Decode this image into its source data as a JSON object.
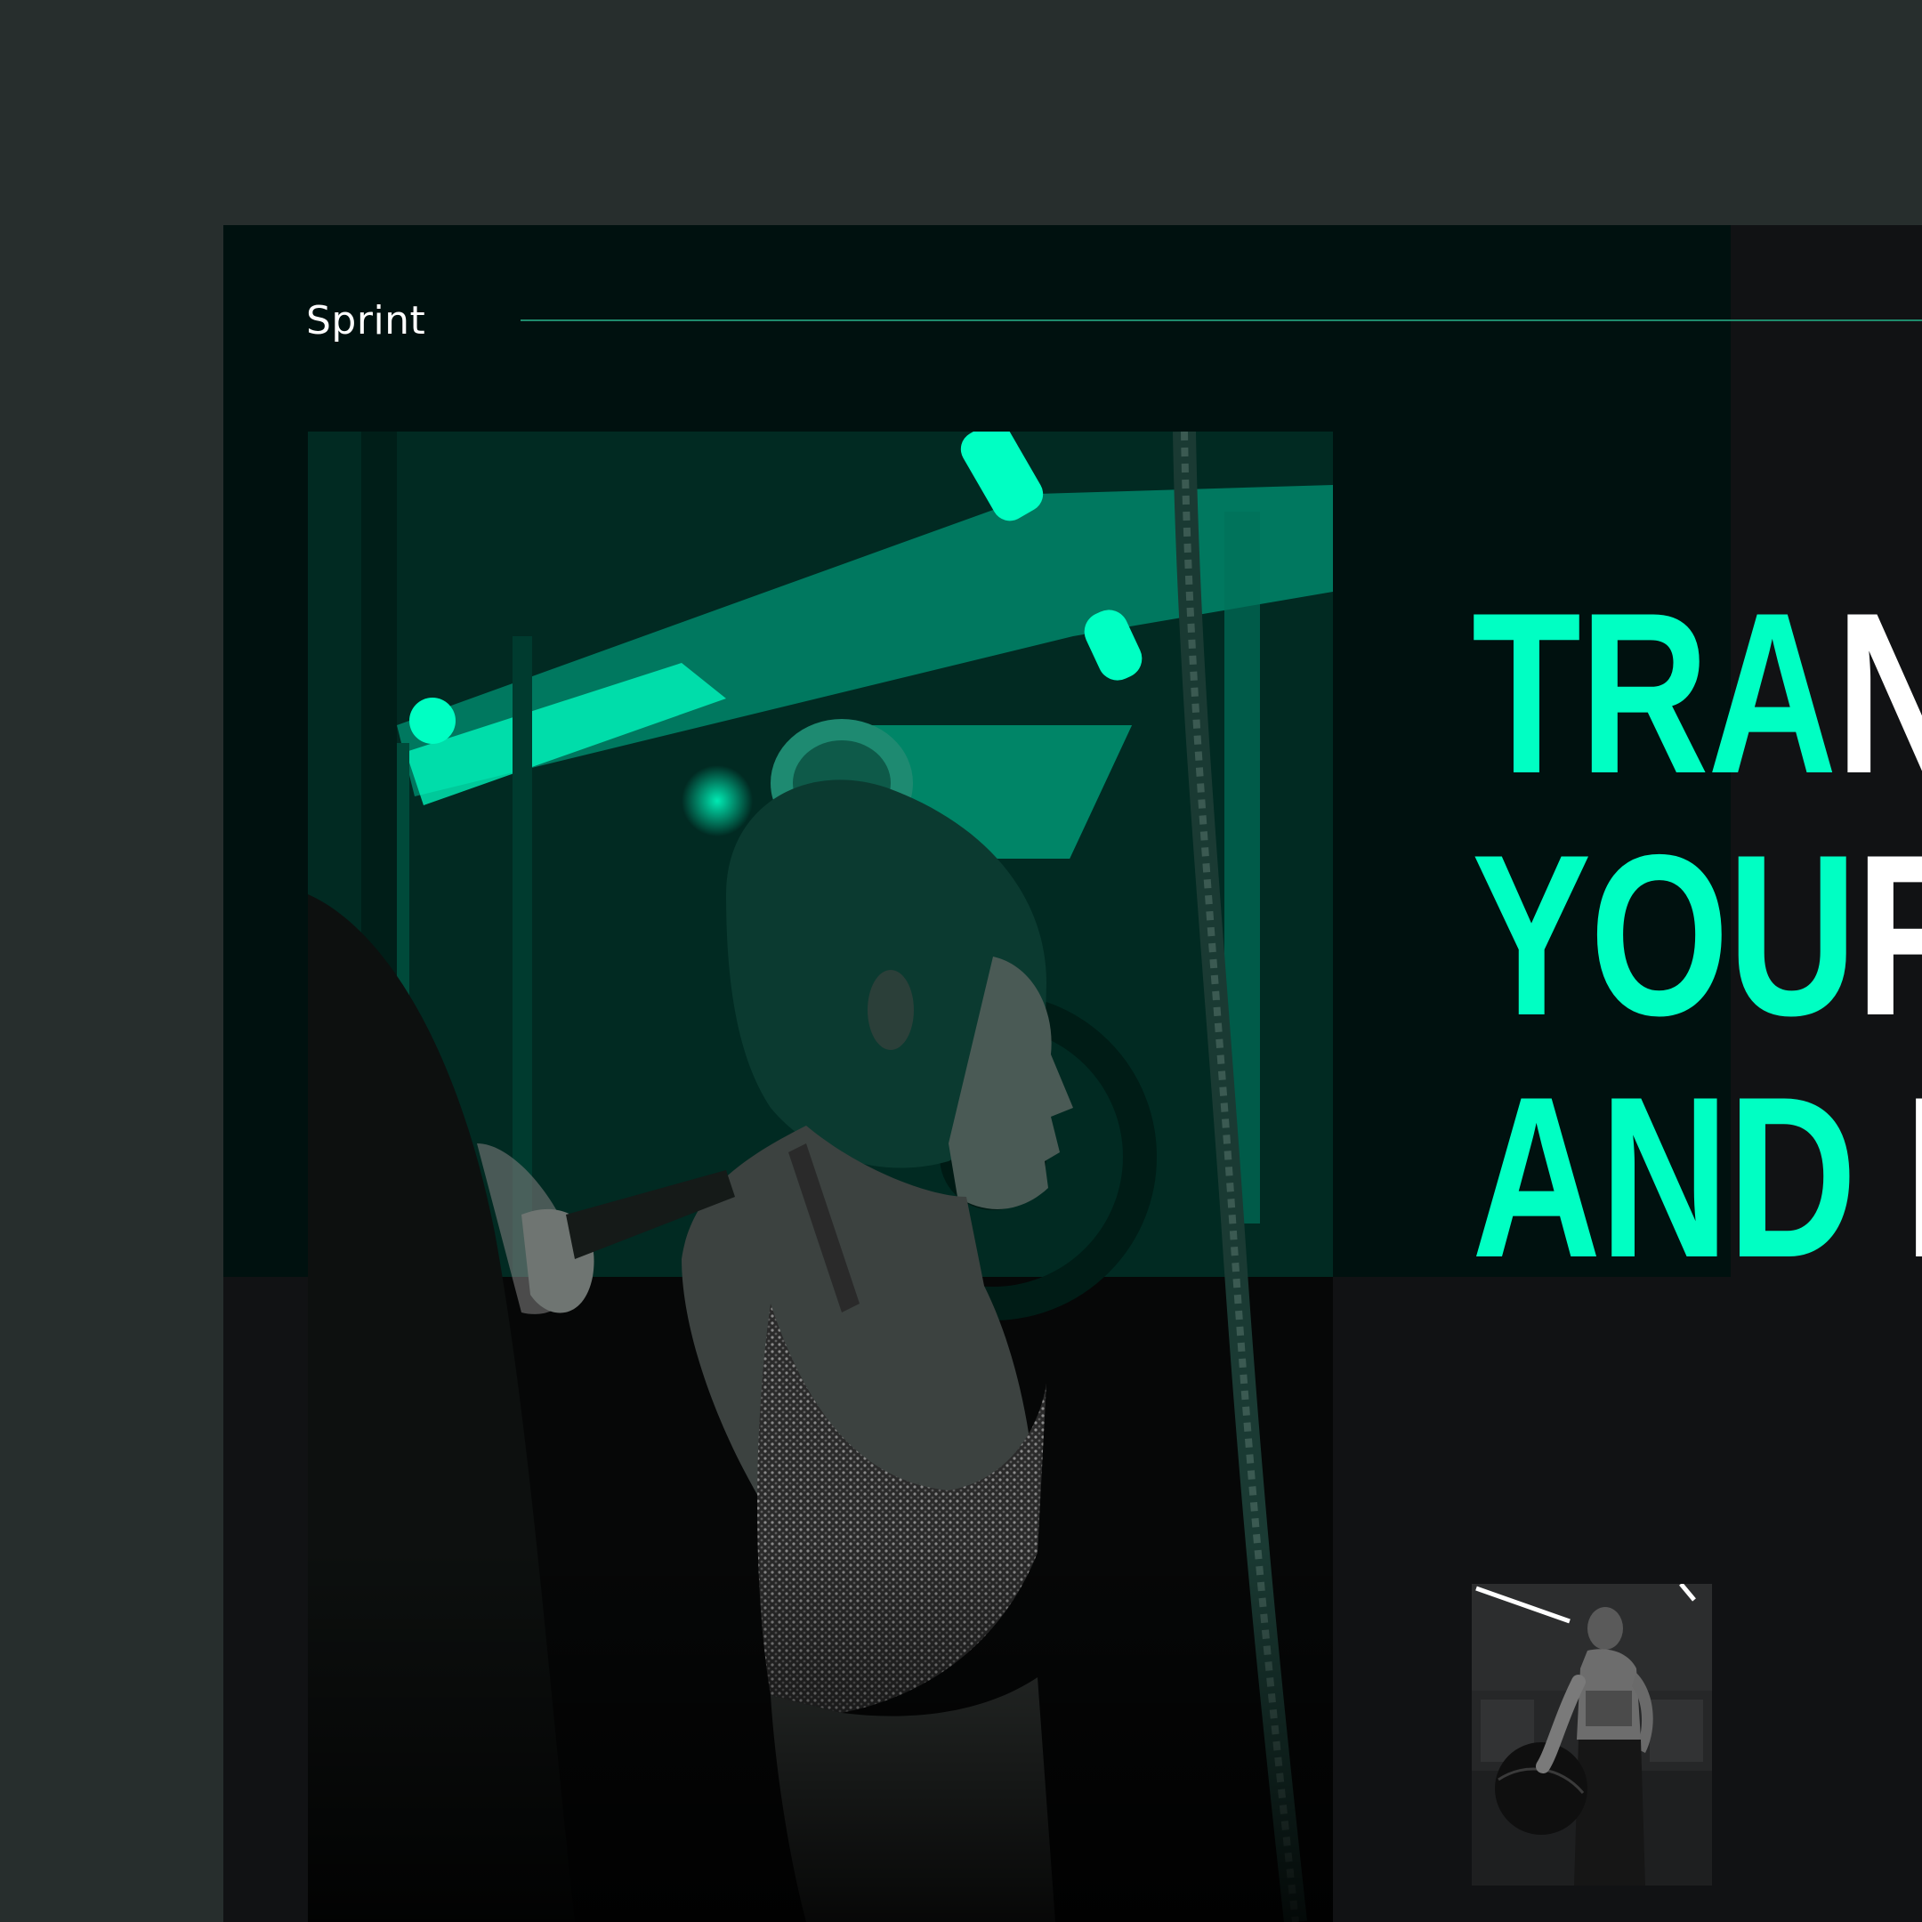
{
  "brand": {
    "name": "Sprint"
  },
  "hero": {
    "headline_lines": [
      {
        "accent": "TRA",
        "rest": "NSF"
      },
      {
        "accent": "YOU",
        "rest": "R B"
      },
      {
        "accent": "AND",
        "rest": " MI"
      }
    ],
    "main_image": "athlete-gym-photo",
    "thumbnail_image": "athlete-with-medicine-ball-photo"
  },
  "colors": {
    "accent": "#00ffc3",
    "outer_background": "#272e2d",
    "panel_background": "#00110f",
    "page_background": "#111214",
    "divider": "#1f8a6c",
    "text": "#ffffff"
  }
}
